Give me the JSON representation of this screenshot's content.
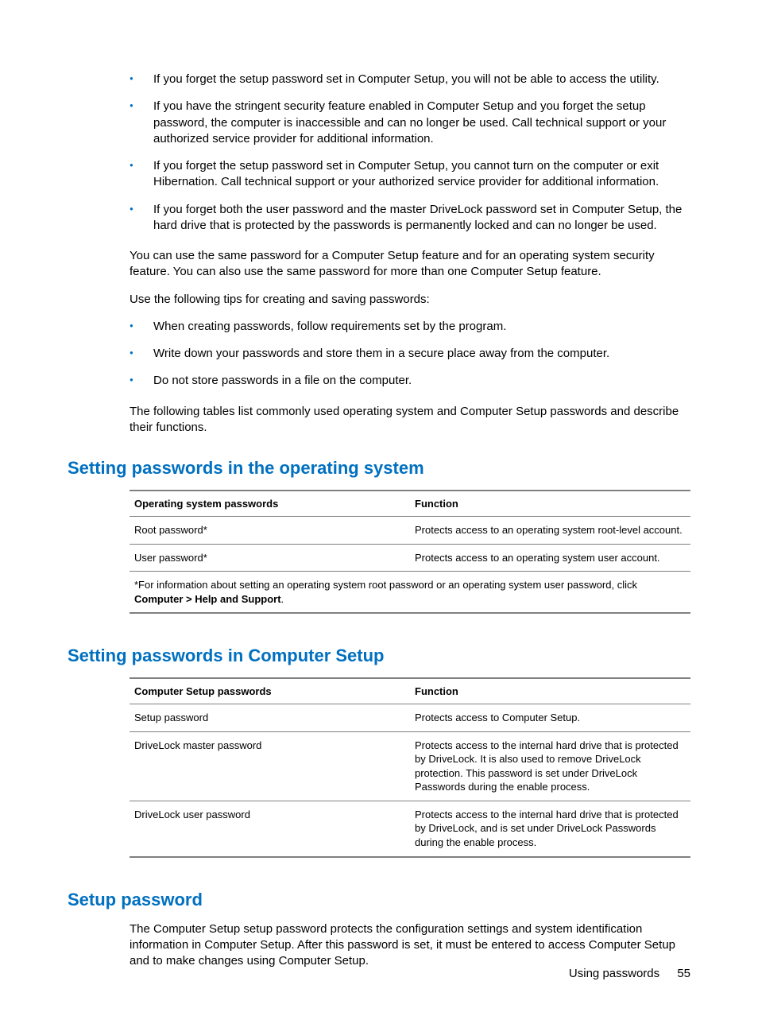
{
  "bullets1": [
    "If you forget the setup password set in Computer Setup, you will not be able to access the utility.",
    "If you have the stringent security feature enabled in Computer Setup and you forget the setup password, the computer is inaccessible and can no longer be used. Call technical support or your authorized service provider for additional information.",
    "If you forget the setup password set in Computer Setup, you cannot turn on the computer or exit Hibernation. Call technical support or your authorized service provider for additional information.",
    "If you forget both the user password and the master DriveLock password set in Computer Setup, the hard drive that is protected by the passwords is permanently locked and can no longer be used."
  ],
  "para1": "You can use the same password for a Computer Setup feature and for an operating system security feature. You can also use the same password for more than one Computer Setup feature.",
  "para2": "Use the following tips for creating and saving passwords:",
  "bullets2": [
    "When creating passwords, follow requirements set by the program.",
    "Write down your passwords and store them in a secure place away from the computer.",
    "Do not store passwords in a file on the computer."
  ],
  "para3": "The following tables list commonly used operating system and Computer Setup passwords and describe their functions.",
  "heading1": "Setting passwords in the operating system",
  "table1": {
    "headers": [
      "Operating system passwords",
      "Function"
    ],
    "rows": [
      [
        "Root password*",
        "Protects access to an operating system root-level account."
      ],
      [
        "User password*",
        "Protects access to an operating system user account."
      ]
    ],
    "footnote_pre": "*For information about setting an operating system root password or an operating system user password, click ",
    "footnote_bold": "Computer > Help and Support",
    "footnote_post": "."
  },
  "heading2": "Setting passwords in Computer Setup",
  "table2": {
    "headers": [
      "Computer Setup passwords",
      "Function"
    ],
    "rows": [
      [
        "Setup password",
        "Protects access to Computer Setup."
      ],
      [
        "DriveLock master password",
        "Protects access to the internal hard drive that is protected by DriveLock. It is also used to remove DriveLock protection. This password is set under DriveLock Passwords during the enable process."
      ],
      [
        "DriveLock user password",
        "Protects access to the internal hard drive that is protected by DriveLock, and is set under DriveLock Passwords during the enable process."
      ]
    ]
  },
  "heading3": "Setup password",
  "para4": "The Computer Setup setup password protects the configuration settings and system identification information in Computer Setup. After this password is set, it must be entered to access Computer Setup and to make changes using Computer Setup.",
  "footer": {
    "label": "Using passwords",
    "page": "55"
  }
}
